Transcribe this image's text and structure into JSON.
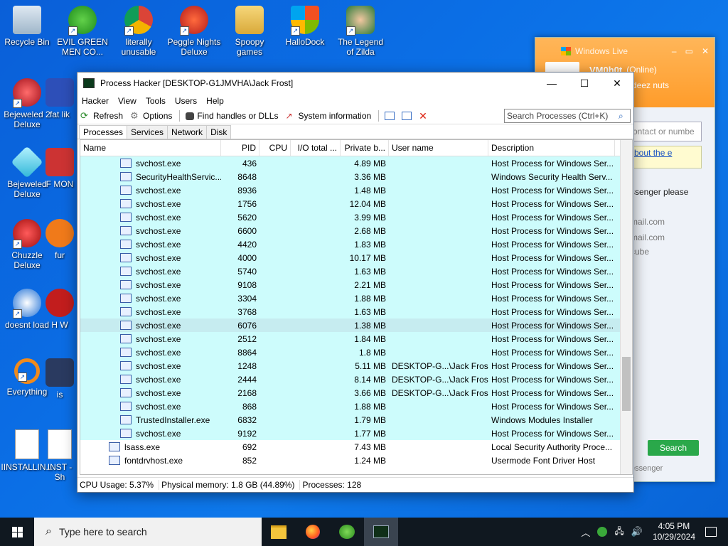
{
  "desktop": {
    "icons": [
      {
        "label": "Recycle Bin"
      },
      {
        "label": "EVIL GREEN MEN CO..."
      },
      {
        "label": "literally unusable"
      },
      {
        "label": "Peggle Nights Deluxe"
      },
      {
        "label": "Spoopy games"
      },
      {
        "label": "HalloDock"
      },
      {
        "label": "The Legend of Zilda"
      },
      {
        "label": "Bejeweled 2 Deluxe"
      },
      {
        "label": "fat lik"
      },
      {
        "label": "Bejeweled Deluxe"
      },
      {
        "label": "F MON"
      },
      {
        "label": "Chuzzle Deluxe"
      },
      {
        "label": "fur"
      },
      {
        "label": "doesnt load"
      },
      {
        "label": "H W"
      },
      {
        "label": "Everything"
      },
      {
        "label": "is"
      },
      {
        "label": "IINSTALLIN..."
      },
      {
        "label": "INST - Sh"
      }
    ]
  },
  "messenger": {
    "title": "Windows Live",
    "user": "VM0h0t",
    "status": "(Online)",
    "subtitle": "deez nuts",
    "search_placeholder": "ontact or numbe",
    "link_text": "bout the e",
    "lines": [
      "ssenger please",
      "mail.com",
      "mail.com",
      "cube"
    ],
    "search_button": "Search",
    "footer": "essenger"
  },
  "processhacker": {
    "title": "Process Hacker [DESKTOP-G1JMVHA\\Jack Frost]",
    "menu": [
      "Hacker",
      "View",
      "Tools",
      "Users",
      "Help"
    ],
    "toolbar": {
      "refresh": "Refresh",
      "options": "Options",
      "find_handles": "Find handles or DLLs",
      "system_info": "System information"
    },
    "search_placeholder": "Search Processes (Ctrl+K)",
    "tabs": [
      "Processes",
      "Services",
      "Network",
      "Disk"
    ],
    "columns": [
      "Name",
      "PID",
      "CPU",
      "I/O total ...",
      "Private b...",
      "User name",
      "Description"
    ],
    "rows": [
      {
        "name": "svchost.exe",
        "pid": "436",
        "cpu": "",
        "io": "",
        "priv": "4.89 MB",
        "user": "",
        "desc": "Host Process for Windows Ser..."
      },
      {
        "name": "SecurityHealthServic...",
        "pid": "8648",
        "cpu": "",
        "io": "",
        "priv": "3.36 MB",
        "user": "",
        "desc": "Windows Security Health Serv..."
      },
      {
        "name": "svchost.exe",
        "pid": "8936",
        "cpu": "",
        "io": "",
        "priv": "1.48 MB",
        "user": "",
        "desc": "Host Process for Windows Ser..."
      },
      {
        "name": "svchost.exe",
        "pid": "1756",
        "cpu": "",
        "io": "",
        "priv": "12.04 MB",
        "user": "",
        "desc": "Host Process for Windows Ser..."
      },
      {
        "name": "svchost.exe",
        "pid": "5620",
        "cpu": "",
        "io": "",
        "priv": "3.99 MB",
        "user": "",
        "desc": "Host Process for Windows Ser..."
      },
      {
        "name": "svchost.exe",
        "pid": "6600",
        "cpu": "",
        "io": "",
        "priv": "2.68 MB",
        "user": "",
        "desc": "Host Process for Windows Ser..."
      },
      {
        "name": "svchost.exe",
        "pid": "4420",
        "cpu": "",
        "io": "",
        "priv": "1.83 MB",
        "user": "",
        "desc": "Host Process for Windows Ser..."
      },
      {
        "name": "svchost.exe",
        "pid": "4000",
        "cpu": "",
        "io": "",
        "priv": "10.17 MB",
        "user": "",
        "desc": "Host Process for Windows Ser..."
      },
      {
        "name": "svchost.exe",
        "pid": "5740",
        "cpu": "",
        "io": "",
        "priv": "1.63 MB",
        "user": "",
        "desc": "Host Process for Windows Ser..."
      },
      {
        "name": "svchost.exe",
        "pid": "9108",
        "cpu": "",
        "io": "",
        "priv": "2.21 MB",
        "user": "",
        "desc": "Host Process for Windows Ser..."
      },
      {
        "name": "svchost.exe",
        "pid": "3304",
        "cpu": "",
        "io": "",
        "priv": "1.88 MB",
        "user": "",
        "desc": "Host Process for Windows Ser..."
      },
      {
        "name": "svchost.exe",
        "pid": "3768",
        "cpu": "",
        "io": "",
        "priv": "1.63 MB",
        "user": "",
        "desc": "Host Process for Windows Ser..."
      },
      {
        "name": "svchost.exe",
        "pid": "6076",
        "cpu": "",
        "io": "",
        "priv": "1.38 MB",
        "user": "",
        "desc": "Host Process for Windows Ser..."
      },
      {
        "name": "svchost.exe",
        "pid": "2512",
        "cpu": "",
        "io": "",
        "priv": "1.84 MB",
        "user": "",
        "desc": "Host Process for Windows Ser..."
      },
      {
        "name": "svchost.exe",
        "pid": "8864",
        "cpu": "",
        "io": "",
        "priv": "1.8 MB",
        "user": "",
        "desc": "Host Process for Windows Ser..."
      },
      {
        "name": "svchost.exe",
        "pid": "1248",
        "cpu": "",
        "io": "",
        "priv": "5.11 MB",
        "user": "DESKTOP-G...\\Jack Frost",
        "desc": "Host Process for Windows Ser..."
      },
      {
        "name": "svchost.exe",
        "pid": "2444",
        "cpu": "",
        "io": "",
        "priv": "8.14 MB",
        "user": "DESKTOP-G...\\Jack Frost",
        "desc": "Host Process for Windows Ser..."
      },
      {
        "name": "svchost.exe",
        "pid": "2168",
        "cpu": "",
        "io": "",
        "priv": "3.66 MB",
        "user": "DESKTOP-G...\\Jack Frost",
        "desc": "Host Process for Windows Ser..."
      },
      {
        "name": "svchost.exe",
        "pid": "868",
        "cpu": "",
        "io": "",
        "priv": "1.88 MB",
        "user": "",
        "desc": "Host Process for Windows Ser..."
      },
      {
        "name": "TrustedInstaller.exe",
        "pid": "6832",
        "cpu": "",
        "io": "",
        "priv": "1.79 MB",
        "user": "",
        "desc": "Windows Modules Installer"
      },
      {
        "name": "svchost.exe",
        "pid": "9192",
        "cpu": "",
        "io": "",
        "priv": "1.77 MB",
        "user": "",
        "desc": "Host Process for Windows Ser..."
      },
      {
        "name": "lsass.exe",
        "pid": "692",
        "cpu": "",
        "io": "",
        "priv": "7.43 MB",
        "user": "",
        "desc": "Local Security Authority Proce..."
      },
      {
        "name": "fontdrvhost.exe",
        "pid": "852",
        "cpu": "",
        "io": "",
        "priv": "1.24 MB",
        "user": "",
        "desc": "Usermode Font Driver Host"
      }
    ],
    "status": {
      "cpu": "CPU Usage: 5.37%",
      "memory": "Physical memory: 1.8 GB (44.89%)",
      "processes": "Processes: 128"
    }
  },
  "taskbar": {
    "search_placeholder": "Type here to search",
    "time": "4:05 PM",
    "date": "10/29/2024"
  }
}
